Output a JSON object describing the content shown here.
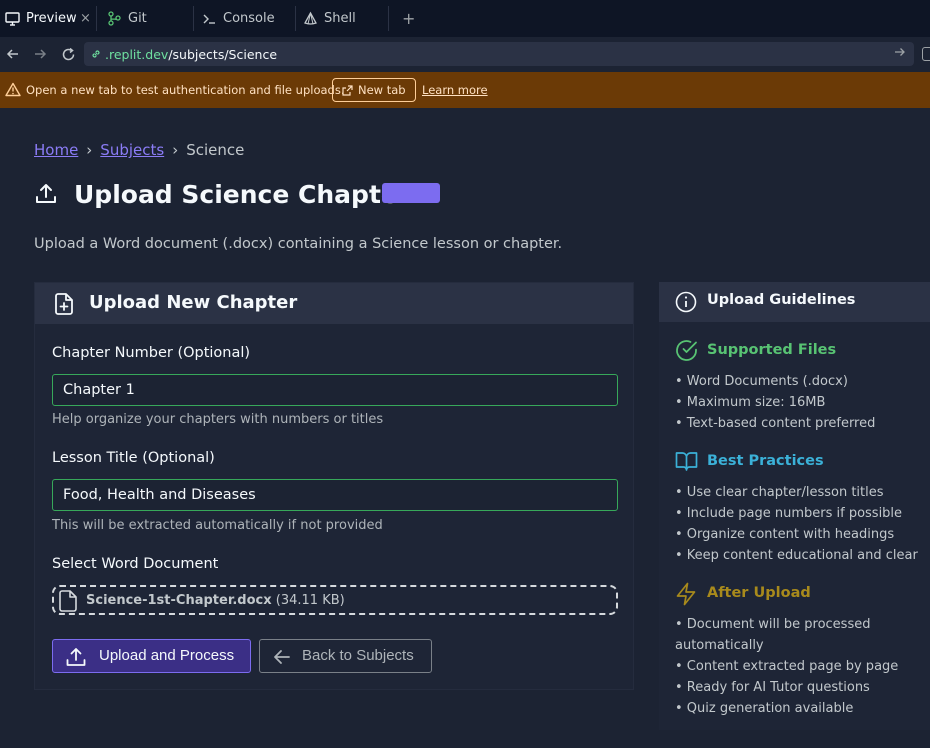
{
  "tabs": [
    {
      "label": "Preview",
      "icon": "monitor-icon",
      "active": true
    },
    {
      "label": "Git",
      "icon": "git-branch-icon",
      "active": false
    },
    {
      "label": "Console",
      "icon": "terminal-icon",
      "active": false
    },
    {
      "label": "Shell",
      "icon": "shell-icon",
      "active": false
    }
  ],
  "tab_close": "×",
  "tab_add": "+",
  "address": {
    "host": ".replit.dev",
    "path": "/subjects/Science"
  },
  "banner": {
    "message": "Open a new tab to test authentication and file uploads.",
    "new_tab_label": "New tab",
    "learn_more_label": "Learn more",
    "color": "#6b3a06"
  },
  "breadcrumb": {
    "home": "Home",
    "subjects": "Subjects",
    "current": "Science",
    "separator": "›"
  },
  "page": {
    "title": "Upload Science Chapter",
    "subtitle": "Upload a Word document (.docx) containing a Science lesson or chapter."
  },
  "upload_card": {
    "title": "Upload New Chapter",
    "chapter_number": {
      "label": "Chapter Number (Optional)",
      "value": "Chapter 1",
      "help": "Help organize your chapters with numbers or titles"
    },
    "lesson_title": {
      "label": "Lesson Title (Optional)",
      "value": "Food, Health and Diseases",
      "help": "This will be extracted automatically if not provided"
    },
    "document": {
      "label": "Select Word Document",
      "file_name": "Science-1st-Chapter.docx",
      "file_size": "(34.11 KB)"
    },
    "upload_button": "Upload and Process",
    "back_button": "Back to Subjects"
  },
  "guidelines": {
    "title": "Upload Guidelines",
    "sections": [
      {
        "title": "Supported Files",
        "icon": "check-circle-icon",
        "color": "#58c373",
        "items": [
          "• Word Documents (.docx)",
          "• Maximum size: 16MB",
          "• Text-based content preferred"
        ]
      },
      {
        "title": "Best Practices",
        "icon": "book-open-icon",
        "color": "#3bb1d8",
        "items": [
          "• Use clear chapter/lesson titles",
          "• Include page numbers if possible",
          "• Organize content with headings",
          "• Keep content educational and clear"
        ]
      },
      {
        "title": "After Upload",
        "icon": "lightning-icon",
        "color": "#a88a1c",
        "items": [
          "• Document will be processed automatically",
          "• Content extracted page by page",
          "• Ready for AI Tutor questions",
          "• Quiz generation available"
        ]
      }
    ]
  },
  "colors": {
    "accent": "#7c6cf0",
    "link": "#8b7cf6",
    "input_border": "#37a85a",
    "background": "#1c2333"
  }
}
